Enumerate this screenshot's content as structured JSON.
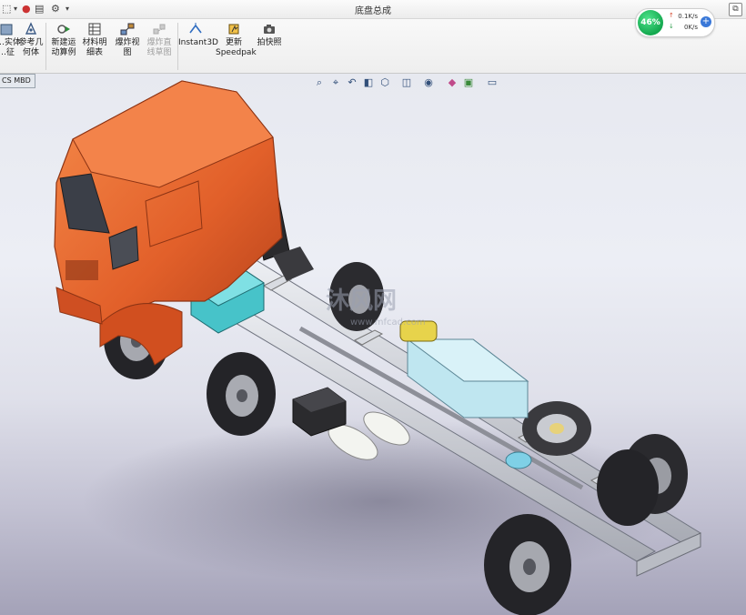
{
  "window": {
    "title": "底盘总成"
  },
  "quick_access": {
    "icons": [
      "select-icon",
      "dropdown-icon",
      "traffic-light-icon",
      "file-props-icon",
      "settings-icon",
      "chevron-down-icon"
    ],
    "corner_icon": "restore-icon",
    "corner_glyph": "⧉"
  },
  "ribbon": {
    "buttons": [
      {
        "label": "…实体\n…征",
        "icon": "solid-body-icon"
      },
      {
        "label": "参考几\n何体",
        "icon": "reference-geometry-icon"
      },
      {
        "label": "新建运\n动算例",
        "icon": "motion-study-icon"
      },
      {
        "label": "材料明\n细表",
        "icon": "bom-icon"
      },
      {
        "label": "爆炸视\n图",
        "icon": "explode-view-icon"
      },
      {
        "label": "爆炸直\n线草图",
        "icon": "explode-line-icon",
        "disabled": true
      },
      {
        "label": "Instant3D",
        "icon": "instant3d-icon"
      },
      {
        "label": "更新\nSpeedpak",
        "icon": "speedpak-icon"
      },
      {
        "label": "拍快照",
        "icon": "camera-icon"
      }
    ]
  },
  "tabs": {
    "mbd": "CS MBD"
  },
  "network": {
    "percent": "46%",
    "up_value": "0.1K/s",
    "down_value": "0K/s",
    "up_arrow": "↑",
    "down_arrow": "↓",
    "add": "+"
  },
  "view_toolbar": {
    "icons": [
      "zoom-fit-icon",
      "zoom-area-icon",
      "previous-view-icon",
      "section-view-icon",
      "view-orientation-icon",
      "display-style-icon",
      "hide-show-icon",
      "edit-appearance-icon",
      "scene-icon",
      "display-settings-icon"
    ],
    "glyphs": [
      "⌕",
      "⌖",
      "↶",
      "◧",
      "⬡",
      "◫",
      "◉",
      "◆",
      "▣",
      "▭"
    ]
  },
  "watermark": {
    "text": "沐风网",
    "url": "www.mfcad.com"
  },
  "colors": {
    "cab": "#e8622c",
    "frame": "#c9ccd3",
    "tank": "#bfe6f0",
    "tire": "#2b2b2b",
    "accent_green": "#20b45a"
  }
}
